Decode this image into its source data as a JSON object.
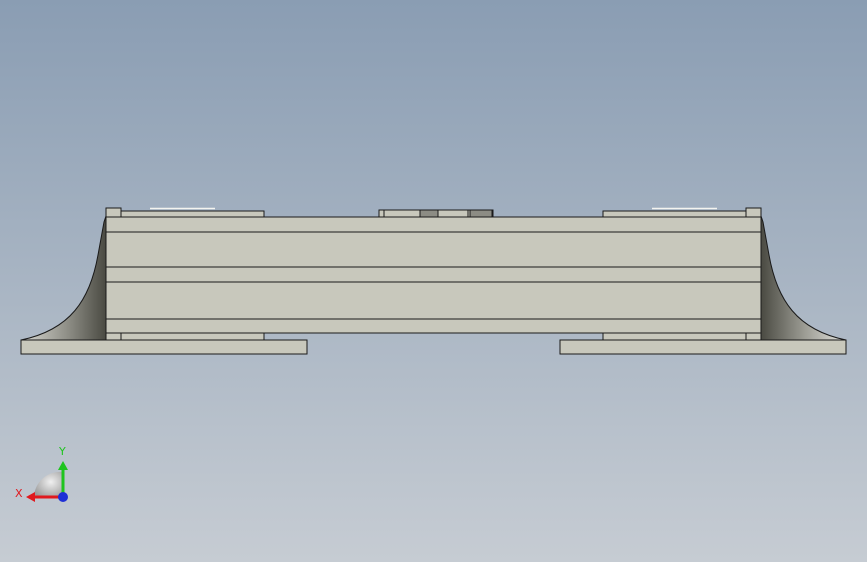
{
  "viewport": {
    "background_top": "#8a9db3",
    "background_bottom": "#c6ccd3",
    "view_orientation": "front"
  },
  "model": {
    "body_color": "#c8c8bc",
    "body_dark": "#b4b4a8",
    "edge_color": "#1a1a1a",
    "fillet_light": "#d8d8d2",
    "fillet_dark": "#4a4a42"
  },
  "triad": {
    "x_label": "X",
    "y_label": "Y",
    "x_color": "#e0191e",
    "y_color": "#1fc41f",
    "z_color": "#1e2fd6",
    "x_icon": "x-axis-arrow",
    "y_icon": "y-axis-arrow",
    "z_icon": "z-axis-dot"
  }
}
